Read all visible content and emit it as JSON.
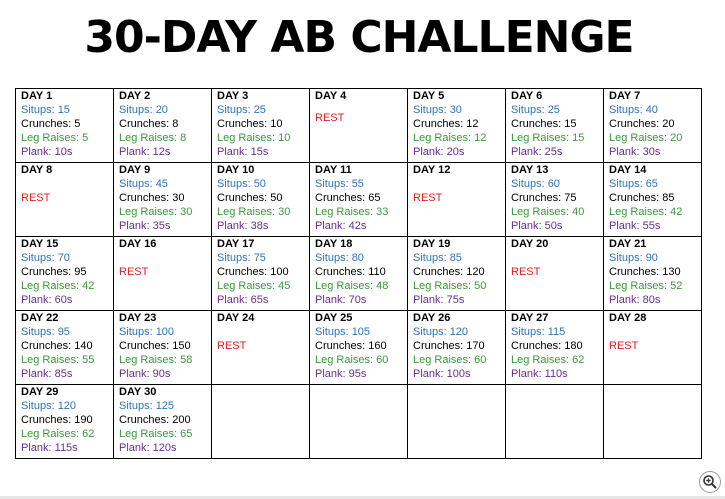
{
  "title": "30-DAY AB CHALLENGE",
  "labels": {
    "situps": "Situps: ",
    "crunches": "Crunches: ",
    "leg_raises": "Leg Raises: ",
    "plank": "Plank: "
  },
  "days": [
    {
      "day": "DAY 1",
      "situps": "15",
      "crunches": "5",
      "leg_raises": "5",
      "plank": "10s"
    },
    {
      "day": "DAY 2",
      "situps": "20",
      "crunches": "8",
      "leg_raises": "8",
      "plank": "12s"
    },
    {
      "day": "DAY 3",
      "situps": "25",
      "crunches": "10",
      "leg_raises": "10",
      "plank": "15s"
    },
    {
      "day": "DAY 4",
      "rest": "REST"
    },
    {
      "day": "DAY 5",
      "situps": "30",
      "crunches": "12",
      "leg_raises": "12",
      "plank": "20s"
    },
    {
      "day": "DAY 6",
      "situps": "25",
      "crunches": "15",
      "leg_raises": "15",
      "plank": "25s"
    },
    {
      "day": "DAY 7",
      "situps": "40",
      "crunches": "20",
      "leg_raises": "20",
      "plank": "30s"
    },
    {
      "day": "DAY 8",
      "rest": "REST"
    },
    {
      "day": "DAY 9",
      "situps": "45",
      "crunches": "30",
      "leg_raises": "30",
      "plank": "35s"
    },
    {
      "day": "DAY 10",
      "situps": "50",
      "crunches": "50",
      "leg_raises": "30",
      "plank": "38s"
    },
    {
      "day": "DAY 11",
      "situps": "55",
      "crunches": "65",
      "leg_raises": "33",
      "plank": "42s"
    },
    {
      "day": "DAY 12",
      "rest": "REST"
    },
    {
      "day": "DAY 13",
      "situps": "60",
      "crunches": "75",
      "leg_raises": "40",
      "plank": "50s"
    },
    {
      "day": "DAY 14",
      "situps": "65",
      "crunches": "85",
      "leg_raises": "42",
      "plank": "55s"
    },
    {
      "day": "DAY 15",
      "situps": "70",
      "crunches": "95",
      "leg_raises": "42",
      "plank": "60s"
    },
    {
      "day": "DAY 16",
      "rest": "REST"
    },
    {
      "day": "DAY 17",
      "situps": "75",
      "crunches": "100",
      "leg_raises": "45",
      "plank": "65s"
    },
    {
      "day": "DAY 18",
      "situps": "80",
      "crunches": "110",
      "leg_raises": "48",
      "plank": "70s"
    },
    {
      "day": "DAY 19",
      "situps": "85",
      "crunches": "120",
      "leg_raises": "50",
      "plank": "75s"
    },
    {
      "day": "DAY 20",
      "rest": "REST"
    },
    {
      "day": "DAY 21",
      "situps": "90",
      "crunches": "130",
      "leg_raises": "52",
      "plank": "80s"
    },
    {
      "day": "DAY 22",
      "situps": "95",
      "crunches": "140",
      "leg_raises": "55",
      "plank": "85s"
    },
    {
      "day": "DAY 23",
      "situps": "100",
      "crunches": "150",
      "leg_raises": "58",
      "plank": "90s"
    },
    {
      "day": "DAY 24",
      "rest": "REST"
    },
    {
      "day": "DAY 25",
      "situps": "105",
      "crunches": "160",
      "leg_raises": "60",
      "plank": "95s"
    },
    {
      "day": "DAY 26",
      "situps": "120",
      "crunches": "170",
      "leg_raises": "60",
      "plank": "100s"
    },
    {
      "day": "DAY 27",
      "situps": "115",
      "crunches": "180",
      "leg_raises": "62",
      "plank": "110s"
    },
    {
      "day": "DAY 28",
      "rest": "REST"
    },
    {
      "day": "DAY 29",
      "situps": "120",
      "crunches": "190",
      "leg_raises": "62",
      "plank": "115s"
    },
    {
      "day": "DAY 30",
      "situps": "125",
      "crunches": "200",
      "leg_raises": "65",
      "plank": "120s"
    }
  ],
  "colors": {
    "situps": "#2e74b5",
    "crunches": "#000000",
    "leg_raises": "#3a9a3a",
    "plank": "#6a2c8f",
    "rest": "#e02020"
  },
  "zoom_icon": "zoom-in-icon"
}
